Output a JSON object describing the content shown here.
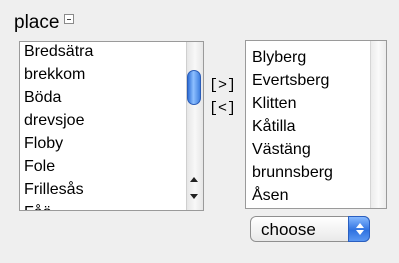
{
  "header": {
    "title": "place"
  },
  "available": {
    "items": [
      "Bredsätra",
      "brekkom",
      "Böda",
      "drevsjoe",
      "Floby",
      "Fole",
      "Frillesås",
      "Fåö..."
    ]
  },
  "buttons": {
    "add": "[>]",
    "remove": "[<]"
  },
  "selected": {
    "items": [
      "Blyberg",
      "Evertsberg",
      "Klitten",
      "Kåtilla",
      "Västäng",
      "brunnsberg",
      "Åsen"
    ]
  },
  "select": {
    "value": "choose"
  },
  "colors": {
    "accent": "#2f72e0",
    "background": "#efefef"
  },
  "icons": {
    "collapse": "collapse-icon",
    "scroll_up": "scroll-up-arrow-icon",
    "scroll_down": "scroll-down-arrow-icon",
    "stepper": "up-down-stepper-icon"
  }
}
